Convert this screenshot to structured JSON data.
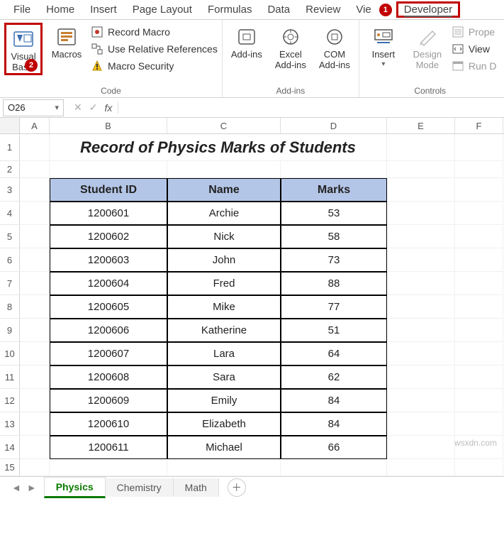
{
  "ribbon_tabs": {
    "file": "File",
    "home": "Home",
    "insert": "Insert",
    "page_layout": "Page Layout",
    "formulas": "Formulas",
    "data": "Data",
    "review": "Review",
    "view": "Vie",
    "developer": "Developer"
  },
  "callouts": {
    "one": "1",
    "two": "2"
  },
  "ribbon": {
    "code": {
      "visual_basic": "Visual Basic",
      "macros": "Macros",
      "record_macro": "Record Macro",
      "use_relative": "Use Relative References",
      "macro_security": "Macro Security",
      "group": "Code"
    },
    "addins": {
      "addins": "Add-ins",
      "excel_addins": "Excel Add-ins",
      "com_addins": "COM Add-ins",
      "group": "Add-ins"
    },
    "controls": {
      "insert": "Insert",
      "design_mode": "Design Mode",
      "properties": "Prope",
      "view_code": "View",
      "run_dialog": "Run D",
      "group": "Controls"
    }
  },
  "formula_bar": {
    "cell_ref": "O26",
    "cancel": "✕",
    "accept": "✓",
    "fx": "fx",
    "value": ""
  },
  "columns": [
    "A",
    "B",
    "C",
    "D",
    "E",
    "F"
  ],
  "row_numbers": [
    "1",
    "2",
    "3",
    "4",
    "5",
    "6",
    "7",
    "8",
    "9",
    "10",
    "11",
    "12",
    "13",
    "14",
    "15"
  ],
  "title": "Record of Physics Marks of Students",
  "headers": {
    "id": "Student ID",
    "name": "Name",
    "marks": "Marks"
  },
  "chart_data": {
    "type": "table",
    "columns": [
      "Student ID",
      "Name",
      "Marks"
    ],
    "rows": [
      [
        "1200601",
        "Archie",
        "53"
      ],
      [
        "1200602",
        "Nick",
        "58"
      ],
      [
        "1200603",
        "John",
        "73"
      ],
      [
        "1200604",
        "Fred",
        "88"
      ],
      [
        "1200605",
        "Mike",
        "77"
      ],
      [
        "1200606",
        "Katherine",
        "51"
      ],
      [
        "1200607",
        "Lara",
        "64"
      ],
      [
        "1200608",
        "Sara",
        "62"
      ],
      [
        "1200609",
        "Emily",
        "84"
      ],
      [
        "1200610",
        "Elizabeth",
        "84"
      ],
      [
        "1200611",
        "Michael",
        "66"
      ]
    ]
  },
  "sheets": {
    "physics": "Physics",
    "chemistry": "Chemistry",
    "math": "Math"
  },
  "watermark": "wsxdn.com"
}
